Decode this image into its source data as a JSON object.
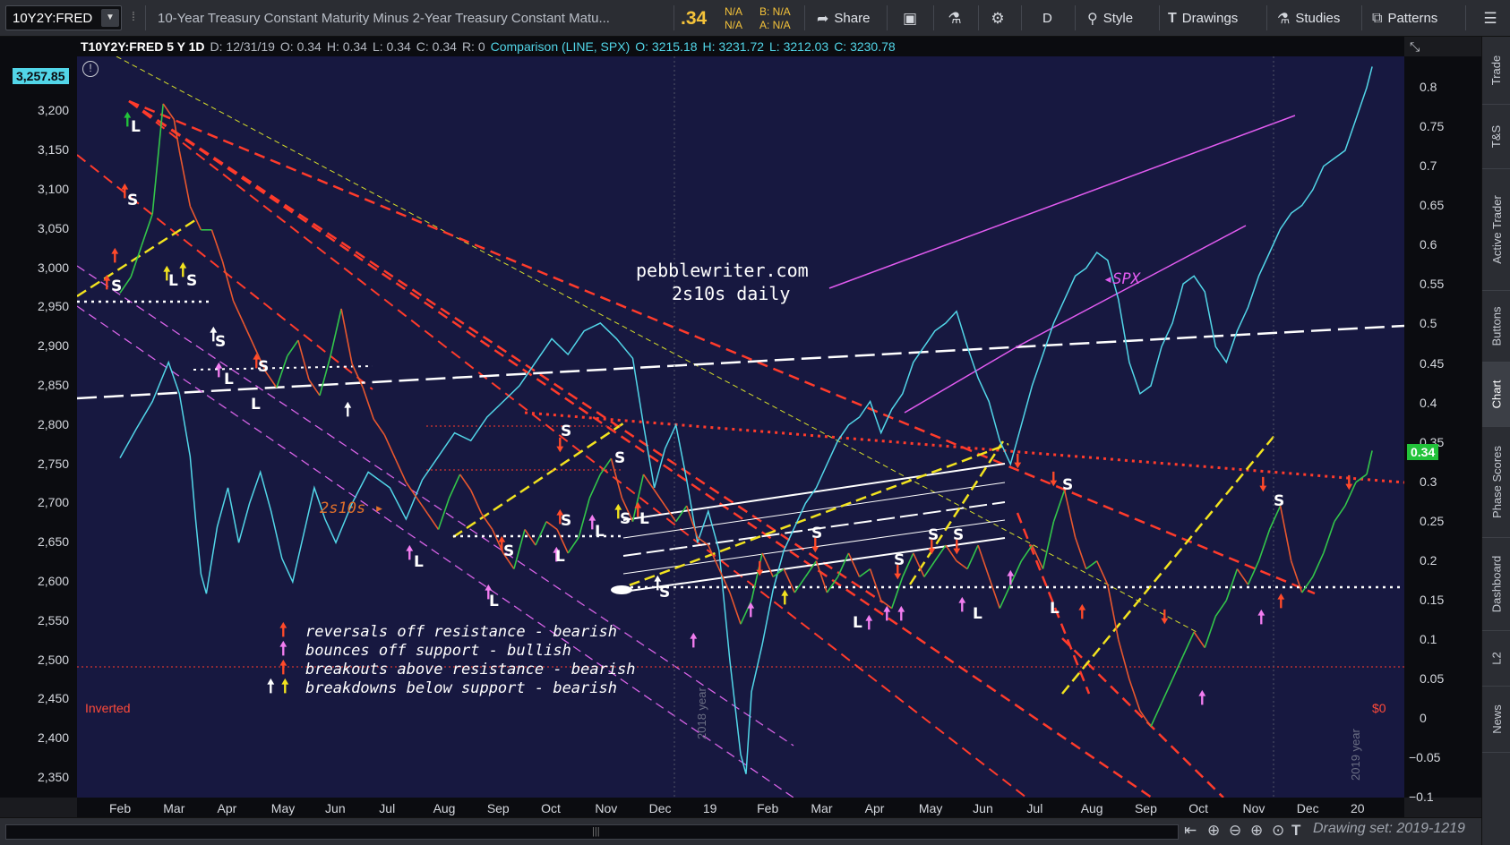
{
  "toolbar": {
    "symbol": "10Y2Y:FRED",
    "description": "10-Year Treasury Constant Maturity Minus 2-Year Treasury Constant Matu...",
    "last": ".34",
    "change_top": "N/A",
    "change_bottom": "N/A",
    "bid": "B: N/A",
    "ask": "A: N/A",
    "share_label": "Share",
    "aggregation": "D",
    "style_label": "Style",
    "drawings_label": "Drawings",
    "studies_label": "Studies",
    "patterns_label": "Patterns",
    "colors": {
      "quote": "#f5c33a"
    }
  },
  "sidebar": {
    "tabs": [
      "Trade",
      "T&S",
      "Active Trader",
      "Buttons",
      "Chart",
      "Phase Scores",
      "Dashboard",
      "L2",
      "News"
    ],
    "active": "Chart"
  },
  "chart_header": {
    "symbol": "T10Y2Y:FRED 5 Y 1D",
    "date": "D: 12/31/19",
    "open": "O: 0.34",
    "high": "H: 0.34",
    "low": "L: 0.34",
    "close": "C: 0.34",
    "range": "R: 0",
    "comparison": "Comparison (LINE, SPX)",
    "cmp_open": "O: 3215.18",
    "cmp_high": "H: 3231.72",
    "cmp_low": "L: 3212.03",
    "cmp_close": "C: 3230.78"
  },
  "badges": {
    "spx_last": "3,257.85",
    "t10_last": "0.34",
    "zero_label": "$0",
    "inverted_label": "Inverted"
  },
  "annotations": {
    "site": "pebblewriter.com",
    "subtitle": "2s10s daily",
    "spx_tag": "SPX",
    "series_tag": "2s10s",
    "year_2018": "2018 year",
    "year_2019": "2019 year",
    "legend": [
      {
        "text": "reversals off resistance - bearish",
        "marks": [
          "red"
        ]
      },
      {
        "text": "bounces off support - bullish",
        "marks": [
          "pink"
        ]
      },
      {
        "text": "breakouts above resistance - bearish",
        "marks": [
          "red"
        ]
      },
      {
        "text": "breakdowns below support - bearish",
        "marks": [
          "white",
          "yellow"
        ]
      }
    ]
  },
  "footer": {
    "drawing_set": "Drawing set: 2019-1219"
  },
  "chart_data": {
    "type": "line",
    "left_axis": {
      "ticks": [
        "3,200",
        "3,150",
        "3,100",
        "3,050",
        "3,000",
        "2,950",
        "2,900",
        "2,850",
        "2,800",
        "2,750",
        "2,700",
        "2,650",
        "2,600",
        "2,550",
        "2,500",
        "2,450",
        "2,400",
        "2,350"
      ],
      "range": [
        2325,
        3270
      ]
    },
    "right_axis": {
      "ticks": [
        "0.8",
        "0.75",
        "0.7",
        "0.65",
        "0.6",
        "0.55",
        "0.5",
        "0.45",
        "0.4",
        "0.35",
        "0.3",
        "0.25",
        "0.2",
        "0.15",
        "0.1",
        "0.05",
        "0",
        "−0.05",
        "−0.1"
      ],
      "range": [
        -0.1,
        0.84
      ]
    },
    "x_ticks": [
      "Feb",
      "Mar",
      "Apr",
      "May",
      "Jun",
      "Jul",
      "Aug",
      "Sep",
      "Oct",
      "Nov",
      "Dec",
      "19",
      "Feb",
      "Mar",
      "Apr",
      "May",
      "Jun",
      "Jul",
      "Aug",
      "Sep",
      "Oct",
      "Nov",
      "Dec",
      "20"
    ],
    "grid": false,
    "series": [
      {
        "name": "SPX",
        "axis": "left",
        "color": "#52d6e8",
        "points": [
          [
            0.0,
            2758
          ],
          [
            0.3,
            2795
          ],
          [
            0.6,
            2830
          ],
          [
            0.9,
            2880
          ],
          [
            1.1,
            2840
          ],
          [
            1.3,
            2760
          ],
          [
            1.4,
            2680
          ],
          [
            1.5,
            2610
          ],
          [
            1.6,
            2585
          ],
          [
            1.8,
            2670
          ],
          [
            2.0,
            2720
          ],
          [
            2.2,
            2650
          ],
          [
            2.4,
            2700
          ],
          [
            2.6,
            2740
          ],
          [
            2.8,
            2690
          ],
          [
            3.0,
            2630
          ],
          [
            3.2,
            2600
          ],
          [
            3.4,
            2660
          ],
          [
            3.6,
            2720
          ],
          [
            3.8,
            2680
          ],
          [
            4.0,
            2650
          ],
          [
            4.3,
            2700
          ],
          [
            4.6,
            2740
          ],
          [
            5.0,
            2720
          ],
          [
            5.3,
            2680
          ],
          [
            5.6,
            2730
          ],
          [
            5.9,
            2760
          ],
          [
            6.2,
            2790
          ],
          [
            6.5,
            2780
          ],
          [
            6.8,
            2810
          ],
          [
            7.1,
            2830
          ],
          [
            7.4,
            2850
          ],
          [
            7.7,
            2880
          ],
          [
            8.0,
            2910
          ],
          [
            8.3,
            2890
          ],
          [
            8.6,
            2920
          ],
          [
            8.9,
            2930
          ],
          [
            9.2,
            2910
          ],
          [
            9.5,
            2885
          ],
          [
            9.7,
            2800
          ],
          [
            9.9,
            2720
          ],
          [
            10.1,
            2770
          ],
          [
            10.3,
            2800
          ],
          [
            10.5,
            2730
          ],
          [
            10.7,
            2650
          ],
          [
            10.9,
            2690
          ],
          [
            11.1,
            2640
          ],
          [
            11.3,
            2500
          ],
          [
            11.5,
            2380
          ],
          [
            11.6,
            2355
          ],
          [
            11.7,
            2460
          ],
          [
            11.9,
            2520
          ],
          [
            12.1,
            2590
          ],
          [
            12.3,
            2640
          ],
          [
            12.5,
            2670
          ],
          [
            12.7,
            2700
          ],
          [
            12.9,
            2720
          ],
          [
            13.1,
            2750
          ],
          [
            13.3,
            2780
          ],
          [
            13.5,
            2800
          ],
          [
            13.7,
            2810
          ],
          [
            13.9,
            2830
          ],
          [
            14.1,
            2790
          ],
          [
            14.3,
            2820
          ],
          [
            14.5,
            2840
          ],
          [
            14.7,
            2880
          ],
          [
            14.9,
            2900
          ],
          [
            15.1,
            2920
          ],
          [
            15.3,
            2930
          ],
          [
            15.5,
            2945
          ],
          [
            15.7,
            2900
          ],
          [
            15.9,
            2860
          ],
          [
            16.1,
            2830
          ],
          [
            16.3,
            2780
          ],
          [
            16.5,
            2750
          ],
          [
            16.7,
            2800
          ],
          [
            16.9,
            2850
          ],
          [
            17.1,
            2890
          ],
          [
            17.3,
            2930
          ],
          [
            17.5,
            2960
          ],
          [
            17.7,
            2990
          ],
          [
            17.9,
            3000
          ],
          [
            18.1,
            3020
          ],
          [
            18.3,
            3010
          ],
          [
            18.5,
            2960
          ],
          [
            18.7,
            2880
          ],
          [
            18.9,
            2840
          ],
          [
            19.1,
            2850
          ],
          [
            19.3,
            2900
          ],
          [
            19.5,
            2930
          ],
          [
            19.7,
            2980
          ],
          [
            19.9,
            2990
          ],
          [
            20.1,
            2970
          ],
          [
            20.3,
            2900
          ],
          [
            20.5,
            2880
          ],
          [
            20.7,
            2920
          ],
          [
            20.9,
            2950
          ],
          [
            21.1,
            2990
          ],
          [
            21.3,
            3020
          ],
          [
            21.5,
            3050
          ],
          [
            21.7,
            3070
          ],
          [
            21.9,
            3080
          ],
          [
            22.1,
            3100
          ],
          [
            22.3,
            3130
          ],
          [
            22.5,
            3140
          ],
          [
            22.7,
            3150
          ],
          [
            22.9,
            3190
          ],
          [
            23.1,
            3230
          ],
          [
            23.2,
            3257
          ]
        ]
      },
      {
        "name": "2s10s",
        "axis": "right",
        "color_up": "#33c64a",
        "color_down": "#e8572e",
        "points": [
          [
            0.0,
            0.54
          ],
          [
            0.2,
            0.56
          ],
          [
            0.4,
            0.6
          ],
          [
            0.6,
            0.64
          ],
          [
            0.8,
            0.78
          ],
          [
            1.0,
            0.76
          ],
          [
            1.1,
            0.72
          ],
          [
            1.3,
            0.65
          ],
          [
            1.5,
            0.62
          ],
          [
            1.7,
            0.62
          ],
          [
            1.9,
            0.58
          ],
          [
            2.1,
            0.53
          ],
          [
            2.3,
            0.5
          ],
          [
            2.5,
            0.47
          ],
          [
            2.7,
            0.44
          ],
          [
            2.9,
            0.42
          ],
          [
            3.1,
            0.46
          ],
          [
            3.3,
            0.48
          ],
          [
            3.5,
            0.43
          ],
          [
            3.7,
            0.41
          ],
          [
            3.9,
            0.46
          ],
          [
            4.1,
            0.52
          ],
          [
            4.3,
            0.45
          ],
          [
            4.5,
            0.42
          ],
          [
            4.7,
            0.38
          ],
          [
            4.9,
            0.36
          ],
          [
            5.1,
            0.33
          ],
          [
            5.3,
            0.3
          ],
          [
            5.5,
            0.28
          ],
          [
            5.7,
            0.26
          ],
          [
            5.9,
            0.24
          ],
          [
            6.1,
            0.28
          ],
          [
            6.3,
            0.31
          ],
          [
            6.5,
            0.29
          ],
          [
            6.7,
            0.26
          ],
          [
            6.9,
            0.24
          ],
          [
            7.1,
            0.21
          ],
          [
            7.3,
            0.19
          ],
          [
            7.5,
            0.24
          ],
          [
            7.7,
            0.22
          ],
          [
            7.9,
            0.25
          ],
          [
            8.1,
            0.24
          ],
          [
            8.3,
            0.21
          ],
          [
            8.5,
            0.23
          ],
          [
            8.7,
            0.28
          ],
          [
            8.9,
            0.31
          ],
          [
            9.1,
            0.33
          ],
          [
            9.3,
            0.28
          ],
          [
            9.5,
            0.25
          ],
          [
            9.7,
            0.31
          ],
          [
            9.9,
            0.29
          ],
          [
            10.1,
            0.27
          ],
          [
            10.3,
            0.25
          ],
          [
            10.5,
            0.27
          ],
          [
            10.7,
            0.23
          ],
          [
            10.9,
            0.22
          ],
          [
            11.1,
            0.19
          ],
          [
            11.3,
            0.16
          ],
          [
            11.5,
            0.12
          ],
          [
            11.7,
            0.15
          ],
          [
            11.9,
            0.21
          ],
          [
            12.1,
            0.18
          ],
          [
            12.3,
            0.19
          ],
          [
            12.5,
            0.16
          ],
          [
            12.7,
            0.18
          ],
          [
            12.9,
            0.2
          ],
          [
            13.1,
            0.16
          ],
          [
            13.3,
            0.18
          ],
          [
            13.5,
            0.21
          ],
          [
            13.7,
            0.18
          ],
          [
            13.9,
            0.19
          ],
          [
            14.1,
            0.15
          ],
          [
            14.3,
            0.14
          ],
          [
            14.5,
            0.18
          ],
          [
            14.7,
            0.21
          ],
          [
            14.9,
            0.18
          ],
          [
            15.1,
            0.2
          ],
          [
            15.3,
            0.22
          ],
          [
            15.5,
            0.2
          ],
          [
            15.7,
            0.19
          ],
          [
            15.9,
            0.22
          ],
          [
            16.1,
            0.18
          ],
          [
            16.3,
            0.14
          ],
          [
            16.5,
            0.17
          ],
          [
            16.7,
            0.2
          ],
          [
            16.9,
            0.22
          ],
          [
            17.1,
            0.19
          ],
          [
            17.3,
            0.25
          ],
          [
            17.5,
            0.29
          ],
          [
            17.7,
            0.23
          ],
          [
            17.9,
            0.19
          ],
          [
            18.1,
            0.2
          ],
          [
            18.3,
            0.17
          ],
          [
            18.5,
            0.1
          ],
          [
            18.7,
            0.05
          ],
          [
            18.9,
            0.01
          ],
          [
            19.1,
            -0.01
          ],
          [
            19.3,
            0.02
          ],
          [
            19.5,
            0.05
          ],
          [
            19.7,
            0.08
          ],
          [
            19.9,
            0.11
          ],
          [
            20.1,
            0.09
          ],
          [
            20.3,
            0.13
          ],
          [
            20.5,
            0.15
          ],
          [
            20.7,
            0.19
          ],
          [
            20.9,
            0.17
          ],
          [
            21.1,
            0.2
          ],
          [
            21.3,
            0.24
          ],
          [
            21.5,
            0.27
          ],
          [
            21.7,
            0.2
          ],
          [
            21.9,
            0.16
          ],
          [
            22.1,
            0.18
          ],
          [
            22.3,
            0.21
          ],
          [
            22.5,
            0.25
          ],
          [
            22.7,
            0.27
          ],
          [
            22.9,
            0.3
          ],
          [
            23.1,
            0.31
          ],
          [
            23.2,
            0.34
          ]
        ]
      }
    ]
  }
}
